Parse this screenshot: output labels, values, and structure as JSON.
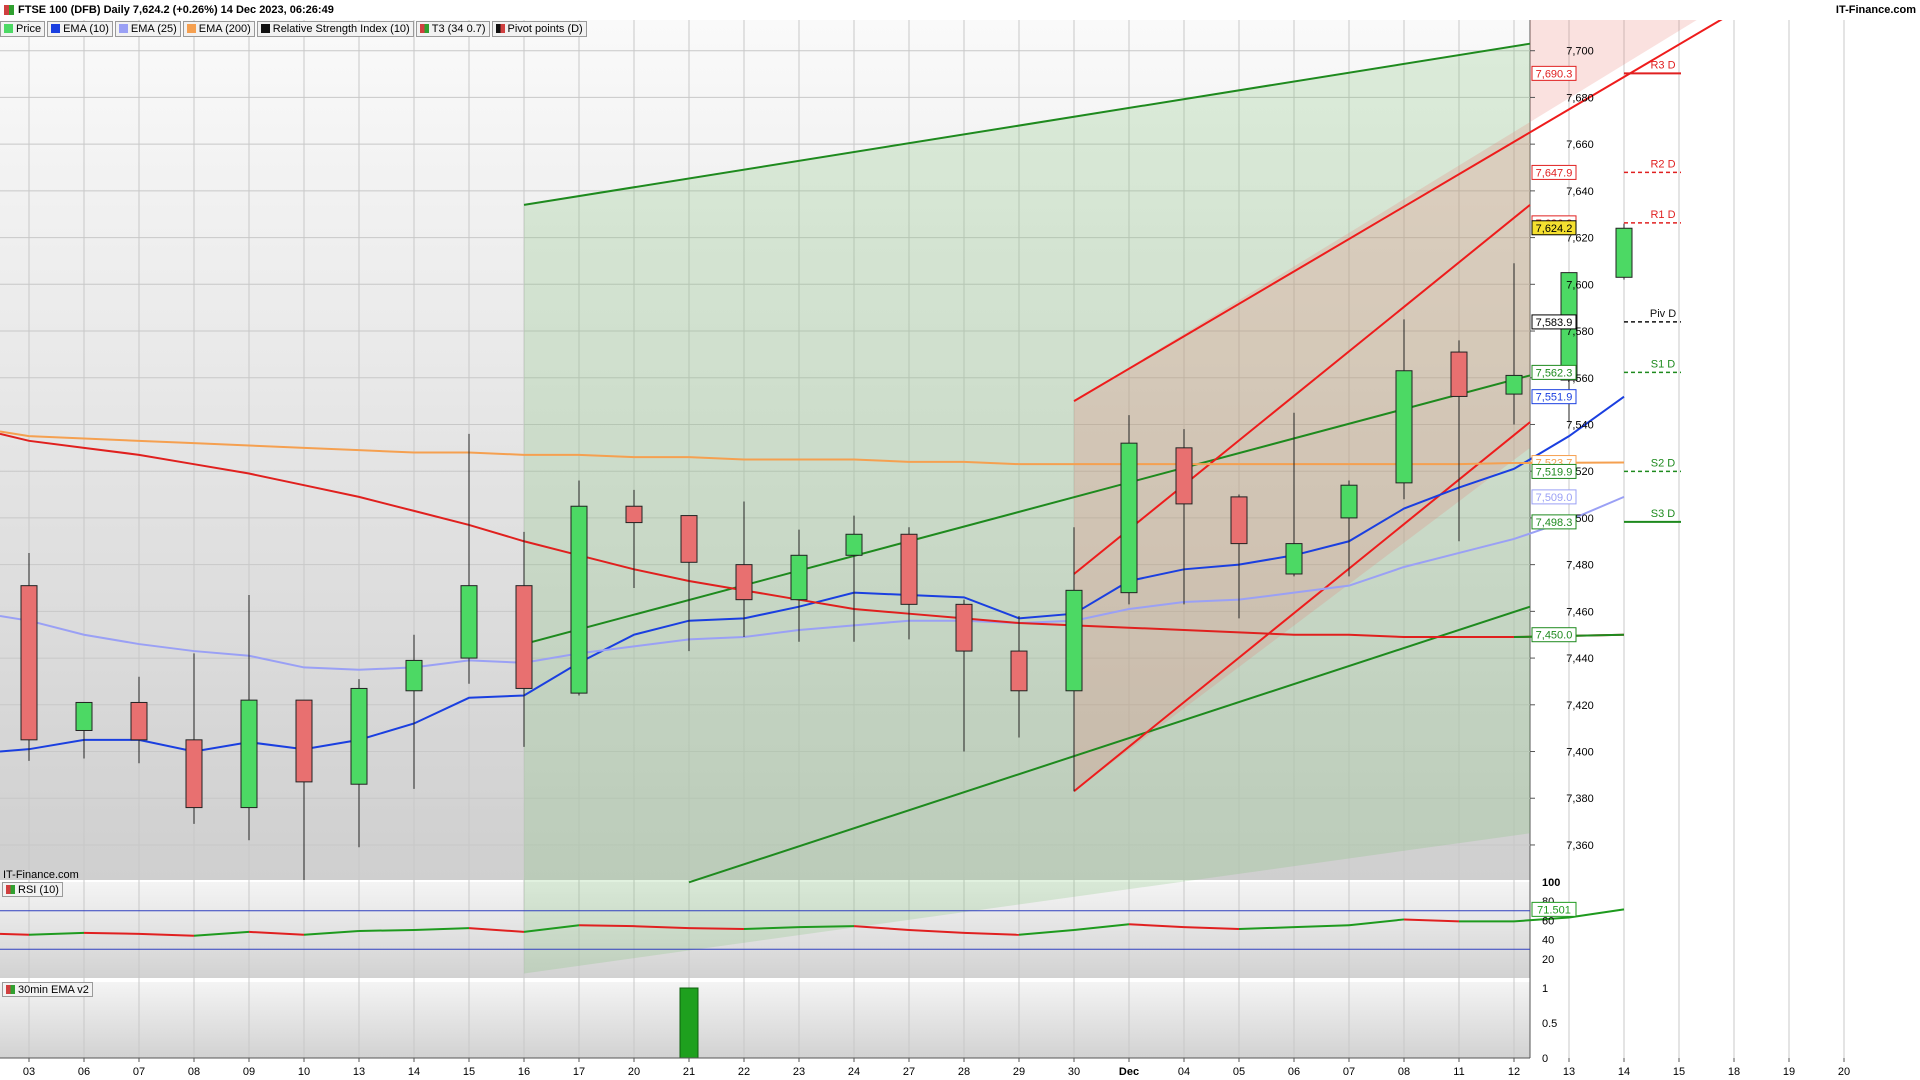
{
  "header": {
    "title": "FTSE 100 (DFB) Daily 7,624.2 (+0.26%) 14 Dec 2023, 06:26:49",
    "site": "IT-Finance.com"
  },
  "legend": [
    {
      "label": "Price",
      "color": "#30a030"
    },
    {
      "label": "EMA (10)",
      "color": "#1a3fe0"
    },
    {
      "label": "EMA (25)",
      "color": "#9aa0f5"
    },
    {
      "label": "EMA (200)",
      "color": "#f5a050"
    },
    {
      "label": "Relative Strength Index (10)",
      "color": "#111111"
    },
    {
      "label": "T3 (34 0.7)",
      "color": "#d02020"
    },
    {
      "label": "Pivot points (D)",
      "color": "#111111"
    }
  ],
  "watermark": "IT-Finance.com",
  "rsi_panel": {
    "label": "RSI (10)",
    "value_badge": "71.501",
    "ticks": [
      "100",
      "80",
      "60",
      "40",
      "20"
    ]
  },
  "ema_panel": {
    "label": "30min EMA v2",
    "ticks": [
      "1",
      "0.5",
      "0"
    ]
  },
  "colors": {
    "bull": "#4cd964",
    "bear": "#e87070",
    "ema10": "#1a3fe0",
    "ema25": "#9aa0f5",
    "ema200": "#f5a050",
    "t3": "#e0201e",
    "channel_green": "#1e8a1e",
    "channel_red": "#ee1c1c"
  },
  "chart_data": {
    "type": "candlestick",
    "title": "FTSE 100 (DFB) Daily",
    "x_labels": [
      "03",
      "06",
      "07",
      "08",
      "09",
      "10",
      "13",
      "14",
      "15",
      "16",
      "17",
      "20",
      "21",
      "22",
      "23",
      "24",
      "27",
      "28",
      "29",
      "30",
      "Dec",
      "04",
      "05",
      "06",
      "07",
      "08",
      "11",
      "12",
      "13",
      "14",
      "15",
      "18",
      "19",
      "20"
    ],
    "y_ticks": [
      7360,
      7380,
      7400,
      7420,
      7440,
      7460,
      7480,
      7500,
      7520,
      7540,
      7560,
      7580,
      7600,
      7620,
      7640,
      7660,
      7680,
      7700
    ],
    "y_tick_labels": [
      "7,360",
      "7,380",
      "7,400",
      "7,420",
      "7,440",
      "7,460",
      "7,480",
      "7,500",
      "7,520",
      "7,540",
      "7,560",
      "7,580",
      "7,600",
      "7,620",
      "7,640",
      "7,660",
      "7,680",
      "7,700"
    ],
    "ylim": [
      7345,
      7714
    ],
    "candles": [
      {
        "date": "03",
        "open": 7471,
        "high": 7485,
        "low": 7396,
        "close": 7405
      },
      {
        "date": "06",
        "open": 7409,
        "high": 7416,
        "low": 7397,
        "close": 7421
      },
      {
        "date": "07",
        "open": 7421,
        "high": 7432,
        "low": 7395,
        "close": 7405
      },
      {
        "date": "08",
        "open": 7405,
        "high": 7442,
        "low": 7369,
        "close": 7376
      },
      {
        "date": "09",
        "open": 7376,
        "high": 7467,
        "low": 7362,
        "close": 7422
      },
      {
        "date": "10",
        "open": 7422,
        "high": 7422,
        "low": 7345,
        "close": 7387
      },
      {
        "date": "13",
        "open": 7386,
        "high": 7431,
        "low": 7359,
        "close": 7427
      },
      {
        "date": "14",
        "open": 7426,
        "high": 7450,
        "low": 7384,
        "close": 7439
      },
      {
        "date": "15",
        "open": 7440,
        "high": 7536,
        "low": 7429,
        "close": 7471
      },
      {
        "date": "16",
        "open": 7471,
        "high": 7494,
        "low": 7402,
        "close": 7427
      },
      {
        "date": "17",
        "open": 7425,
        "high": 7516,
        "low": 7424,
        "close": 7505
      },
      {
        "date": "20",
        "open": 7505,
        "high": 7512,
        "low": 7470,
        "close": 7498
      },
      {
        "date": "21",
        "open": 7501,
        "high": 7501,
        "low": 7443,
        "close": 7481
      },
      {
        "date": "22",
        "open": 7480,
        "high": 7507,
        "low": 7449,
        "close": 7465
      },
      {
        "date": "23",
        "open": 7465,
        "high": 7495,
        "low": 7447,
        "close": 7484
      },
      {
        "date": "24",
        "open": 7484,
        "high": 7501,
        "low": 7447,
        "close": 7493
      },
      {
        "date": "27",
        "open": 7493,
        "high": 7496,
        "low": 7448,
        "close": 7463
      },
      {
        "date": "28",
        "open": 7463,
        "high": 7465,
        "low": 7400,
        "close": 7443
      },
      {
        "date": "29",
        "open": 7443,
        "high": 7458,
        "low": 7406,
        "close": 7426
      },
      {
        "date": "30",
        "open": 7426,
        "high": 7496,
        "low": 7383,
        "close": 7469
      },
      {
        "date": "Dec",
        "open": 7468,
        "high": 7544,
        "low": 7463,
        "close": 7532
      },
      {
        "date": "04",
        "open": 7530,
        "high": 7538,
        "low": 7463,
        "close": 7506
      },
      {
        "date": "05",
        "open": 7509,
        "high": 7510,
        "low": 7457,
        "close": 7489
      },
      {
        "date": "06",
        "open": 7476,
        "high": 7545,
        "low": 7475,
        "close": 7489
      },
      {
        "date": "07",
        "open": 7500,
        "high": 7516,
        "low": 7475,
        "close": 7514
      },
      {
        "date": "08",
        "open": 7515,
        "high": 7585,
        "low": 7508,
        "close": 7563
      },
      {
        "date": "11",
        "open": 7571,
        "high": 7576,
        "low": 7490,
        "close": 7552
      },
      {
        "date": "12",
        "open": 7553,
        "high": 7609,
        "low": 7540,
        "close": 7561
      },
      {
        "date": "13",
        "open": 7559,
        "high": 7604,
        "low": 7541,
        "close": 7605
      },
      {
        "date": "14",
        "open": 7603,
        "high": 7626,
        "low": 7602,
        "close": 7624
      }
    ],
    "series": [
      {
        "name": "EMA (10)",
        "values": [
          7401,
          7405,
          7405,
          7400,
          7404,
          7401,
          7405,
          7412,
          7423,
          7424,
          7438,
          7450,
          7456,
          7457,
          7462,
          7468,
          7467,
          7466,
          7457,
          7459,
          7473,
          7478,
          7480,
          7484,
          7490,
          7504,
          7513,
          7521,
          7535,
          7551.9
        ]
      },
      {
        "name": "EMA (25)",
        "values": [
          7456,
          7450,
          7446,
          7443,
          7441,
          7436,
          7435,
          7436,
          7439,
          7438,
          7442,
          7445,
          7448,
          7449,
          7452,
          7454,
          7456,
          7456,
          7455,
          7456,
          7461,
          7464,
          7465,
          7468,
          7471,
          7479,
          7485,
          7491,
          7499,
          7509.0
        ]
      },
      {
        "name": "EMA (200)",
        "values": [
          7535,
          7534,
          7533,
          7532,
          7531,
          7530,
          7529,
          7528,
          7528,
          7527,
          7527,
          7526,
          7526,
          7525,
          7525,
          7525,
          7524,
          7524,
          7523,
          7523,
          7523,
          7523,
          7523,
          7523,
          7523,
          7523,
          7523,
          7523.5,
          7523.6,
          7523.7
        ]
      },
      {
        "name": "T3 (34 0.7)",
        "values": [
          7533,
          7530,
          7527,
          7523,
          7519,
          7514,
          7509,
          7503,
          7497,
          7490,
          7484,
          7478,
          7473,
          7469,
          7465,
          7461,
          7459,
          7457,
          7455,
          7454,
          7453,
          7452,
          7451,
          7450,
          7450,
          7449,
          7449,
          7449,
          7449.5,
          7450.0
        ]
      }
    ],
    "pivots": [
      {
        "label": "R3 D",
        "value": 7690.3
      },
      {
        "label": "R2 D",
        "value": 7647.9
      },
      {
        "label": "R1 D",
        "value": 7626.3
      },
      {
        "label": "Piv D",
        "value": 7583.9
      },
      {
        "label": "S1 D",
        "value": 7562.3
      },
      {
        "label": "S2 D",
        "value": 7519.9
      },
      {
        "label": "S3 D",
        "value": 7498.3
      }
    ],
    "price_badges": [
      {
        "value": 7690.3,
        "text": "7,690.3"
      },
      {
        "value": 7647.9,
        "text": "7,647.9"
      },
      {
        "value": 7626.3,
        "text": "7,626.3"
      },
      {
        "value": 7624.2,
        "text": "7,624.2"
      },
      {
        "value": 7583.9,
        "text": "7,583.9"
      },
      {
        "value": 7562.3,
        "text": "7,562.3"
      },
      {
        "value": 7551.9,
        "text": "7,551.9"
      },
      {
        "value": 7523.7,
        "text": "7,523.7"
      },
      {
        "value": 7519.9,
        "text": "7,519.9"
      },
      {
        "value": 7509.0,
        "text": "7,509.0"
      },
      {
        "value": 7498.3,
        "text": "7,498.3"
      },
      {
        "value": 7450.0,
        "text": "7,450.0"
      }
    ],
    "rsi": {
      "ylim": [
        0,
        100
      ],
      "overbought": 70,
      "oversold": 30,
      "values": [
        45,
        47,
        46,
        44,
        48,
        45,
        49,
        50,
        52,
        48,
        55,
        54,
        52,
        51,
        53,
        54,
        50,
        47,
        45,
        50,
        56,
        53,
        51,
        53,
        55,
        61,
        59,
        59,
        63,
        71.5
      ]
    },
    "ema_v2": {
      "ylim": [
        0,
        1
      ],
      "bars": [
        {
          "date": "21",
          "value": 1
        }
      ]
    }
  }
}
